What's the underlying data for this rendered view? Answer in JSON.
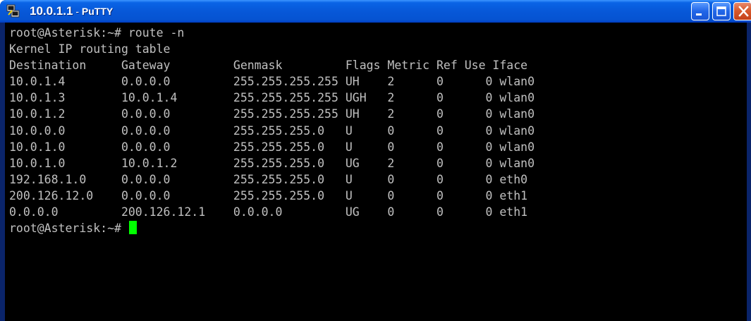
{
  "window": {
    "title_host": "10.0.1.1",
    "title_sep": " - ",
    "title_app": "PuTTY",
    "colors": {
      "titlebar": "#0758d8",
      "terminal_bg": "#000000",
      "terminal_fg": "#c0c0c0",
      "cursor": "#00ff00",
      "close_button": "#d85a2e"
    },
    "icons": {
      "app": "putty-icon",
      "minimize": "minimize-icon",
      "maximize": "maximize-icon",
      "close": "close-icon"
    }
  },
  "terminal": {
    "lines": [
      "root@Asterisk:~# route -n",
      "Kernel IP routing table",
      "Destination     Gateway         Genmask         Flags Metric Ref Use Iface",
      "10.0.1.4        0.0.0.0         255.255.255.255 UH    2      0      0 wlan0",
      "10.0.1.3        10.0.1.4        255.255.255.255 UGH   2      0      0 wlan0",
      "10.0.1.2        0.0.0.0         255.255.255.255 UH    2      0      0 wlan0",
      "10.0.0.0        0.0.0.0         255.255.255.0   U     0      0      0 wlan0",
      "10.0.1.0        0.0.0.0         255.255.255.0   U     0      0      0 wlan0",
      "10.0.1.0        10.0.1.2        255.255.255.0   UG    2      0      0 wlan0",
      "192.168.1.0     0.0.0.0         255.255.255.0   U     0      0      0 eth0",
      "200.126.12.0    0.0.0.0         255.255.255.0   U     0      0      0 eth1",
      "0.0.0.0         200.126.12.1    0.0.0.0         UG    0      0      0 eth1"
    ],
    "prompt": "root@Asterisk:~# "
  }
}
